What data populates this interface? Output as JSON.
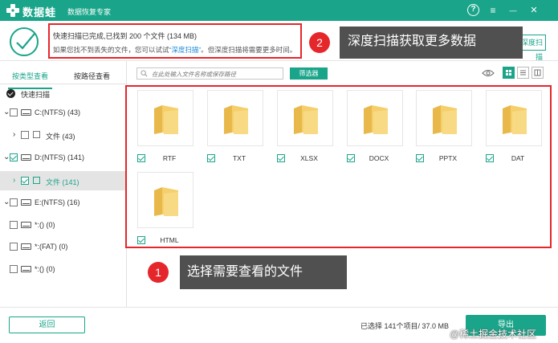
{
  "titlebar": {
    "app_name": "数据蛙",
    "app_sub": "数据恢复专家",
    "help": "?",
    "menu": "≡",
    "minimize": "—",
    "close": "✕"
  },
  "header": {
    "scan_line1": "快速扫描已完成,已找到 200 个文件 (134 MB)",
    "scan_line2_pre": "如果您找不到丢失的文件，您可以试试",
    "scan_line2_link": "“深度扫描”",
    "scan_line2_post": "。但深度扫描将需要更多时间。",
    "deep_scan_button": "深度扫描"
  },
  "annotations": {
    "callout2_num": "2",
    "callout2_text": "深度扫描获取更多数据",
    "callout1_num": "1",
    "callout1_text": "选择需要查看的文件"
  },
  "left": {
    "tab_type": "按类型查看",
    "tab_path": "按路径查看",
    "quick_scan": "快速扫描",
    "drive_c": "C:(NTFS) (43)",
    "c_files": "文件 (43)",
    "drive_d": "D:(NTFS) (141)",
    "d_files": "文件 (141)",
    "drive_e": "E:(NTFS) (16)",
    "drive_x1": "*:() (0)",
    "drive_fat": "*:(FAT) (0)",
    "drive_x2": "*:() (0)"
  },
  "toolbar": {
    "search_placeholder": "在此处输入文件名称或保存路径",
    "filter_button": "筛选器"
  },
  "files": [
    "RTF",
    "TXT",
    "XLSX",
    "DOCX",
    "PPTX",
    "DAT",
    "HTML"
  ],
  "bottom": {
    "back_button": "返回",
    "selected_info": "已选择 141个项目/ 37.0 MB",
    "export_button": "导出",
    "watermark": "@稀土掘金技术社区"
  },
  "colors": {
    "accent": "#1aa58a",
    "annotation_red": "#e5262b",
    "callout_bg": "#505050",
    "folder_yellow": "#f5cf6b"
  }
}
